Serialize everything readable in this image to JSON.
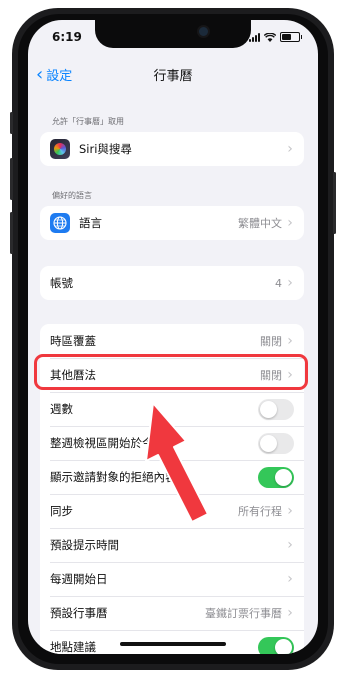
{
  "status_bar": {
    "time": "6:19"
  },
  "nav": {
    "back_label": "設定",
    "title": "行事曆"
  },
  "sections": {
    "access_label": "允許「行事曆」取用",
    "language_label": "偏好的語言"
  },
  "rows": {
    "siri": {
      "label": "Siri與搜尋"
    },
    "language": {
      "label": "語言",
      "value": "繁體中文"
    },
    "accounts": {
      "label": "帳號",
      "value": "4"
    },
    "timezone": {
      "label": "時區覆蓋",
      "value": "關閉"
    },
    "alt_calendars": {
      "label": "其他曆法",
      "value": "關閉"
    },
    "week_numbers": {
      "label": "週數",
      "on": false
    },
    "week_view": {
      "label": "整週檢視區開始於今天",
      "on": false
    },
    "declined": {
      "label": "顯示邀請對象的拒絕內容",
      "on": true
    },
    "sync": {
      "label": "同步",
      "value": "所有行程"
    },
    "alert_times": {
      "label": "預設提示時間"
    },
    "start_week": {
      "label": "每週開始日"
    },
    "default_calendar": {
      "label": "預設行事曆",
      "value": "臺鐵訂票行事曆"
    },
    "location": {
      "label": "地點建議",
      "on": true
    }
  },
  "icons": {
    "back": "chevron-left-icon",
    "chevron": "chevron-right-icon",
    "siri": "siri-icon",
    "language": "globe-icon",
    "signal": "cellular-signal-icon",
    "wifi": "wifi-icon",
    "battery": "battery-icon"
  },
  "colors": {
    "accent": "#0a84ff",
    "toggle_on": "#34c759",
    "highlight": "#f0383e",
    "arrow": "#f0383e"
  }
}
